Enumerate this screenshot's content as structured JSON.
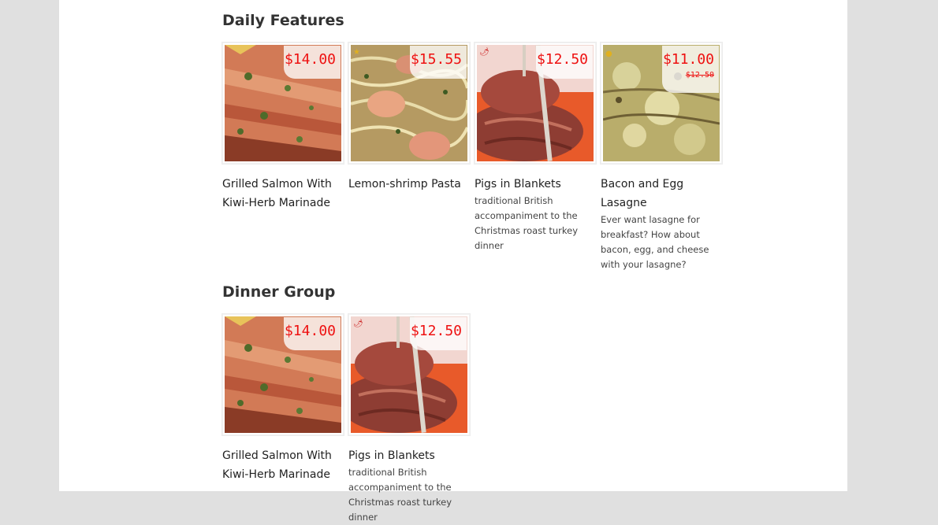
{
  "colors": {
    "price": "#ee1111",
    "page_background": "#e0e0e0",
    "content_background": "#ffffff",
    "heading": "#333333"
  },
  "sections": [
    {
      "title": "Daily Features",
      "items": [
        {
          "name": "Grilled Salmon With Kiwi-Herb Marinade",
          "price": "$14.00",
          "photo_icon": "salmon-photo",
          "description": ""
        },
        {
          "name": "Lemon-shrimp Pasta",
          "price": "$15.55",
          "photo_icon": "shrimp-pasta-photo",
          "badge_icon": "star-icon",
          "description": ""
        },
        {
          "name": "Pigs in Blankets",
          "price": "$12.50",
          "photo_icon": "pigs-in-blankets-photo",
          "badge_icon": "pepper-icon",
          "description": "traditional British accompaniment to the Christmas roast turkey dinner"
        },
        {
          "name": "Bacon and Egg Lasagne",
          "price": "$11.00",
          "old_price": "$12.50",
          "photo_icon": "lasagne-photo",
          "badge_icon": "sun-icon",
          "description": "Ever want lasagne for breakfast? How about bacon, egg, and cheese with your lasagne?"
        }
      ]
    },
    {
      "title": "Dinner Group",
      "items": [
        {
          "name": "Grilled Salmon With Kiwi-Herb Marinade",
          "price": "$14.00",
          "photo_icon": "salmon-photo",
          "description": ""
        },
        {
          "name": "Pigs in Blankets",
          "price": "$12.50",
          "photo_icon": "pigs-in-blankets-photo",
          "badge_icon": "pepper-icon",
          "description": "traditional British accompaniment to the Christmas roast turkey dinner"
        }
      ]
    }
  ]
}
